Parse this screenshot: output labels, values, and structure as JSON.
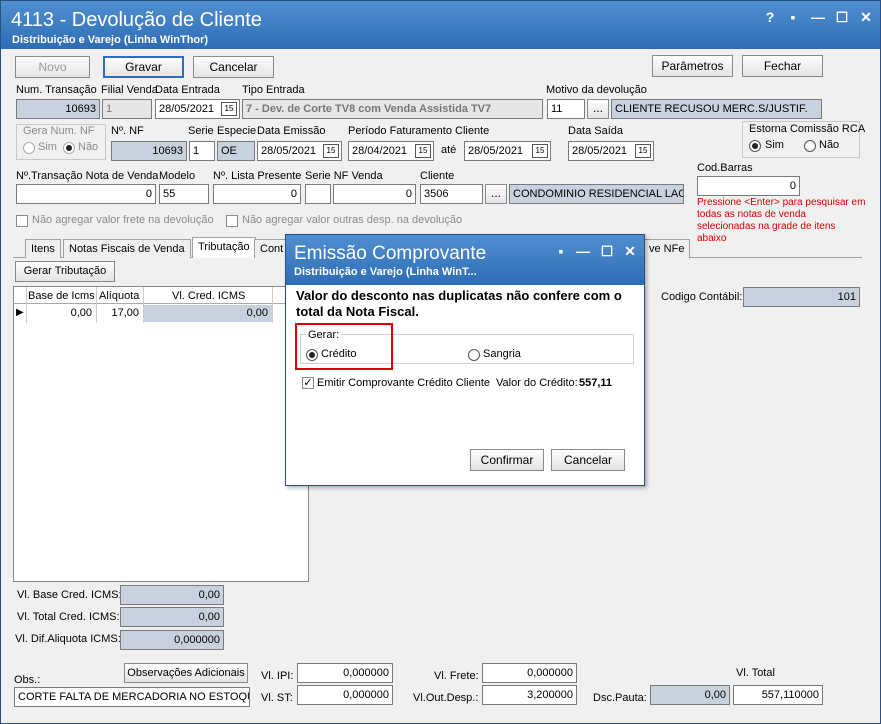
{
  "window": {
    "title": "4113 - Devolução de Cliente",
    "subtitle": "Distribuição e Varejo (Linha WinThor)",
    "controls": [
      "?",
      "▪",
      "—",
      "☐",
      "✕"
    ]
  },
  "toolbar": {
    "novo": "Novo",
    "gravar": "Gravar",
    "cancelar": "Cancelar",
    "parametros": "Parâmetros",
    "fechar": "Fechar"
  },
  "header": {
    "num_transacao_label": "Num. Transação",
    "num_transacao": "10693",
    "filial_venda_label": "Filial Venda",
    "filial_venda": "1",
    "data_entrada_label": "Data Entrada",
    "data_entrada": "28/05/2021",
    "tipo_entrada_label": "Tipo Entrada",
    "tipo_entrada": "7 - Dev. de Corte TV8 com Venda Assistida TV7",
    "motivo_label": "Motivo da devolução",
    "motivo_cod": "11",
    "motivo_desc": "CLIENTE RECUSOU MERC.S/JUSTIF.",
    "gera_num_nf_label": "Gera Num. NF",
    "sim": "Sim",
    "nao": "Não",
    "num_nf_label": "Nº. NF",
    "num_nf": "10693",
    "serie_label": "Serie",
    "serie": "1",
    "especie_label": "Especie",
    "especie": "OE",
    "data_emissao_label": "Data Emissão",
    "data_emissao": "28/05/2021",
    "periodo_label": "Período Faturamento Cliente",
    "periodo_ini": "28/04/2021",
    "ate": "até",
    "periodo_fim": "28/05/2021",
    "data_saida_label": "Data Saída",
    "data_saida": "28/05/2021",
    "estorna_label": "Estorna Comissão RCA",
    "estorna_sim": "Sim",
    "estorna_nao": "Não",
    "transacao_nota_label": "Nº.Transação Nota de Venda",
    "transacao_nota": "0",
    "modelo_label": "Modelo",
    "modelo": "55",
    "lista_presente_label": "Nº. Lista Presente",
    "lista_presente": "0",
    "serie_nf_label": "Serie NF Venda",
    "serie_nf_num": "0",
    "cliente_label": "Cliente",
    "cliente_cod": "3506",
    "cliente_nome": "CONDOMINIO RESIDENCIAL LAGOI",
    "cod_barras_label": "Cod.Barras",
    "cod_barras": "0",
    "cod_barras_hint": "Pressione <Enter> para pesquisar em todas as notas de venda selecionadas na grade de itens abaixo",
    "chk_frete": "Não agregar valor frete  na devolução",
    "chk_outras": "Não agregar valor outras desp. na devolução"
  },
  "tabs": [
    "Itens",
    "Notas Fiscais de Venda",
    "Tributação",
    "Cont",
    "ve NFe"
  ],
  "tributacao": {
    "gerar_btn": "Gerar Tributação",
    "columns": [
      "Base de Icms",
      "Alíquota",
      "Vl. Cred. ICMS"
    ],
    "rows": [
      [
        "0,00",
        "17,00",
        "0,00"
      ]
    ],
    "codigo_contabil_label": "Codigo Contábil:",
    "codigo_contabil": "101",
    "vl_base_label": "Vl. Base Cred. ICMS:",
    "vl_base": "0,00",
    "vl_total_label": "Vl. Total Cred. ICMS:",
    "vl_total": "0,00",
    "vl_dif_label": "Vl. Dif.Aliquota ICMS:",
    "vl_dif": "0,000000"
  },
  "footer": {
    "obs_label": "Obs.:",
    "obs_btn": "Observações Adicionais",
    "obs": "CORTE FALTA DE MERCADORIA NO ESTOQUE",
    "vl_ipi_label": "Vl. IPI:",
    "vl_ipi": "0,000000",
    "vl_st_label": "Vl. ST:",
    "vl_st": "0,000000",
    "vl_frete_label": "Vl. Frete:",
    "vl_frete": "0,000000",
    "vl_out_label": "Vl.Out.Desp.:",
    "vl_out": "3,200000",
    "dsc_pauta_label": "Dsc.Pauta:",
    "dsc_pauta": "0,00",
    "vl_total_label": "Vl. Total",
    "vl_total": "557,110000"
  },
  "dialog": {
    "title": "Emissão Comprovante",
    "subtitle": "Distribuição e Varejo (Linha WinT...",
    "message": "Valor do desconto nas duplicatas não confere com o total da Nota Fiscal.",
    "gerar_label": "Gerar:",
    "credito": "Crédito",
    "sangria": "Sangria",
    "emitir_label": "Emitir Comprovante Crédito Cliente",
    "valor_credito_label": "Valor do Crédito:",
    "valor_credito": "557,11",
    "confirmar": "Confirmar",
    "cancelar": "Cancelar"
  }
}
